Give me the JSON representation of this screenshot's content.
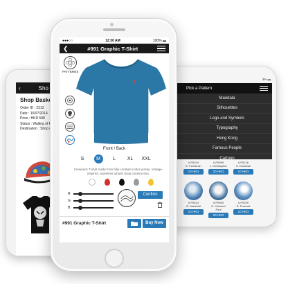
{
  "basket_phone": {
    "header_fragment": "Sho",
    "title": "Shop  Basket",
    "info_lines": [
      "Order ID : 2313",
      "Date : 15/07/2014",
      "Price : HKD 598",
      "Status : Waiting of Payme",
      "Destination : Shop (Cod"
    ]
  },
  "pattern_phone": {
    "status_right": "4% ▬",
    "header_title": "Pick a Pattern",
    "menu_items": [
      "Mandala",
      "Silhouettes",
      "Logo and Symbols",
      "Typography",
      "Hong Kong",
      "Famous People",
      "Cartoon"
    ],
    "tiles": [
      {
        "code": "# P0024",
        "artist": "E. Felicia An",
        "price": "10 HKD"
      },
      {
        "code": "# P0099",
        "artist": "J. Christopher",
        "price": "20 HKD"
      },
      {
        "code": "# P0216",
        "artist": "H. Donahue",
        "price": "10 HKD"
      },
      {
        "code": "# P0814",
        "artist": "R. Marshall",
        "price": "10 HKD"
      },
      {
        "code": "# P0063",
        "artist": "D. Osmond Paul",
        "price": "20 HKD"
      },
      {
        "code": "# P0039",
        "artist": "R. Prescott",
        "price": "10 HKD"
      }
    ]
  },
  "main_phone": {
    "status_time": "12:30 AM",
    "status_battery": "100% ▬",
    "title": "#991  Graphic T-Shirt",
    "patterns_label": "PATTERNS",
    "view_label": "Front / Back",
    "sizes": [
      "S",
      "M",
      "L",
      "XL",
      "XXL"
    ],
    "selected_size": "M",
    "description": "Crewneck T-shirt made from fully combed cotton jersey. Vintage-inspired, seamless tubular body construction.",
    "rgb_labels": [
      "R",
      "G",
      "B"
    ],
    "rgb_values": [
      0.18,
      0.18,
      0.18
    ],
    "confirm_label": "Confirm",
    "bottom_title": "#991  Graphic T-Shirt",
    "buy_label": "Buy Now",
    "shirt_color": "#2b78a6",
    "accent_color": "#2a7ab8"
  }
}
